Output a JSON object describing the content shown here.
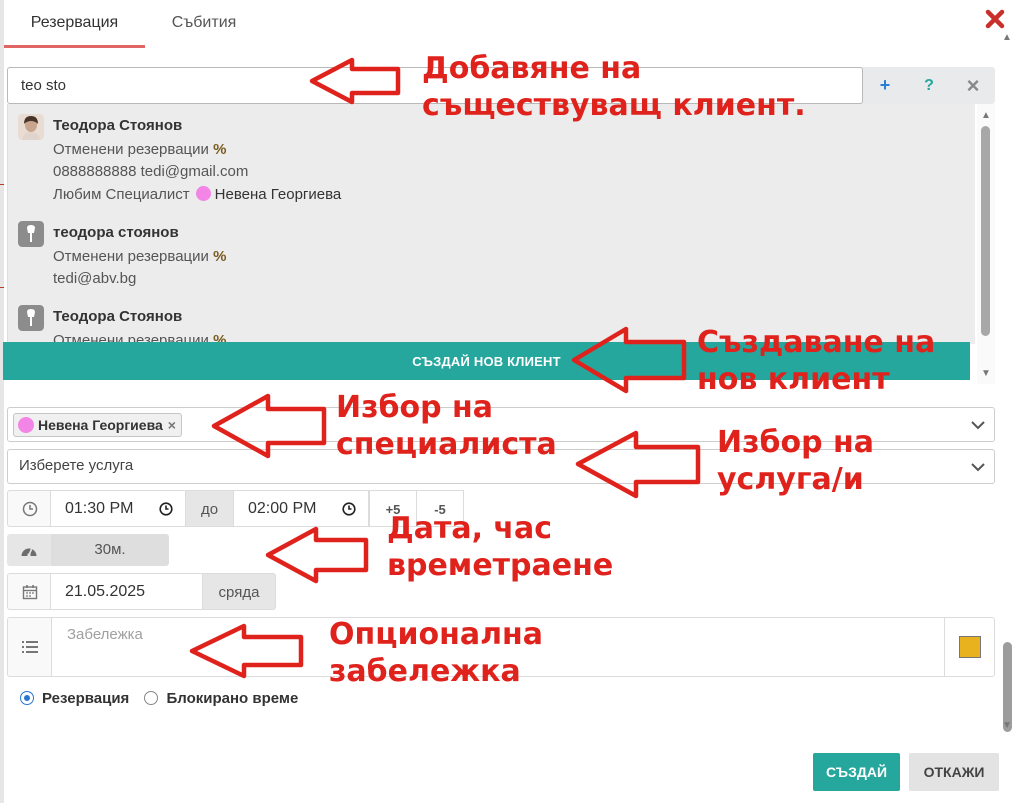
{
  "tabs": [
    {
      "label": "Резервация",
      "active": true
    },
    {
      "label": "Събития",
      "active": false
    }
  ],
  "search": {
    "value": "teo sto",
    "add_label": "+",
    "help_label": "?",
    "clear_label": "×"
  },
  "clients": [
    {
      "name": "Теодора Стоянов",
      "cancelled_label": "Отменени резервации",
      "percent": "%",
      "contact": "0888888888 tedi@gmail.com",
      "favorite_label": "Любим Специалист",
      "favorite_specialist": "Невена Георгиева",
      "has_photo": true
    },
    {
      "name": "теодора стоянов",
      "cancelled_label": "Отменени резервации",
      "percent": "%",
      "contact": "tedi@abv.bg",
      "has_photo": false
    },
    {
      "name": "Теодора Стоянов",
      "cancelled_label": "Отменени резервации",
      "percent": "%",
      "has_photo": false
    }
  ],
  "new_client_button": "СЪЗДАЙ НОВ КЛИЕНТ",
  "specialist": {
    "selected": "Невена Георгиева",
    "remove_label": "×",
    "color": "#f285e6"
  },
  "service": {
    "placeholder": "Изберете услуга"
  },
  "time": {
    "start": "01:30 PM",
    "separator": "до",
    "end": "02:00 PM",
    "plus_label": "+5",
    "minus_label": "-5"
  },
  "duration": {
    "value": "30м."
  },
  "date": {
    "value": "21.05.2025",
    "weekday": "сряда"
  },
  "note": {
    "placeholder": "Забележка",
    "color": "#e8b21e"
  },
  "type": {
    "options": [
      "Резервация",
      "Блокирано време"
    ],
    "selected": "Резервация"
  },
  "actions": {
    "create": "СЪЗДАЙ",
    "cancel": "ОТКАЖИ"
  },
  "annotations": {
    "add_existing": [
      "Добавяне на",
      "съществуващ клиент."
    ],
    "create_new": [
      "Създаване на",
      "нов клиент"
    ],
    "choose_specialist": [
      "Избор на",
      "специалиста"
    ],
    "choose_service": [
      "Избор на",
      "услуга/и"
    ],
    "date_time": [
      "Дата, час",
      "времетраене"
    ],
    "optional_note": [
      "Опционална",
      "забележка"
    ]
  },
  "colors": {
    "accent": "#25a79d",
    "annotation": "#e0221c",
    "tab_underline": "#e06666"
  }
}
